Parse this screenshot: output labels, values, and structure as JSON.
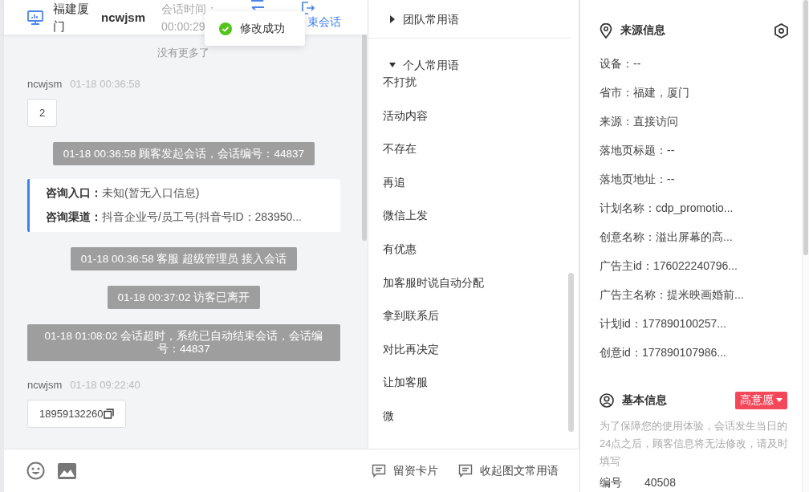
{
  "chat": {
    "header": {
      "location": "福建厦门",
      "name": "ncwjsm",
      "time_label": "会话时间：",
      "time_value": "00:00:29",
      "end_label": "束会话"
    },
    "load_more": "没有更多了",
    "messages": [
      {
        "kind": "user",
        "sender": "ncwjsm",
        "time": "01-18 00:36:58",
        "text": "2",
        "copyable": false
      },
      {
        "kind": "notice",
        "text": "01-18 00:36:58 顾客发起会话，会话编号：44837"
      },
      {
        "kind": "info",
        "rows": [
          {
            "label": "咨询入口：",
            "value": "未知(暂无入口信息)"
          },
          {
            "label": "咨询渠道：",
            "value": "抖音企业号/员工号(抖音号ID：283950..."
          }
        ]
      },
      {
        "kind": "notice",
        "text": "01-18 00:36:58 客服 超级管理员 接入会话"
      },
      {
        "kind": "notice",
        "text": "01-18 00:37:02 访客已离开"
      },
      {
        "kind": "notice",
        "text": "01-18 01:08:02 会话超时，系统已自动结束会话，会话编号：44837"
      },
      {
        "kind": "user",
        "sender": "ncwjsm",
        "time": "01-18 09:22:40",
        "text": "18959132260",
        "copyable": true
      }
    ]
  },
  "toast": {
    "text": "修改成功"
  },
  "phrases": {
    "groups": [
      {
        "title": "团队常用语",
        "expanded": false
      },
      {
        "title": "个人常用语",
        "expanded": true,
        "items": [
          "不打扰",
          "活动内容",
          "不存在",
          "再追",
          "微信上发",
          "有优惠",
          "加客服时说自动分配",
          "拿到联系后",
          "对比再决定",
          "让加客服",
          "微"
        ]
      }
    ]
  },
  "footer": {
    "buttons": [
      "留资卡片",
      "收起图文常用语"
    ]
  },
  "source": {
    "title": "来源信息",
    "rows": [
      "设备：--",
      "省市：福建，厦门",
      "来源：直接访问",
      "落地页标题：--",
      "落地页地址：--",
      "计划名称：cdp_promotio...",
      "创意名称：溢出屏幕的高...",
      "广告主id：176022240796...",
      "广告主名称：提米映画婚前...",
      "计划id：177890100257...",
      "创意id：177890107986..."
    ]
  },
  "basic": {
    "title": "基本信息",
    "tag": "高意愿",
    "note": "为了保障您的使用体验，会话发生当日的24点之后，顾客信息将无法修改，请及时填写",
    "rows": [
      {
        "label": "编号",
        "value": "40508"
      }
    ]
  }
}
